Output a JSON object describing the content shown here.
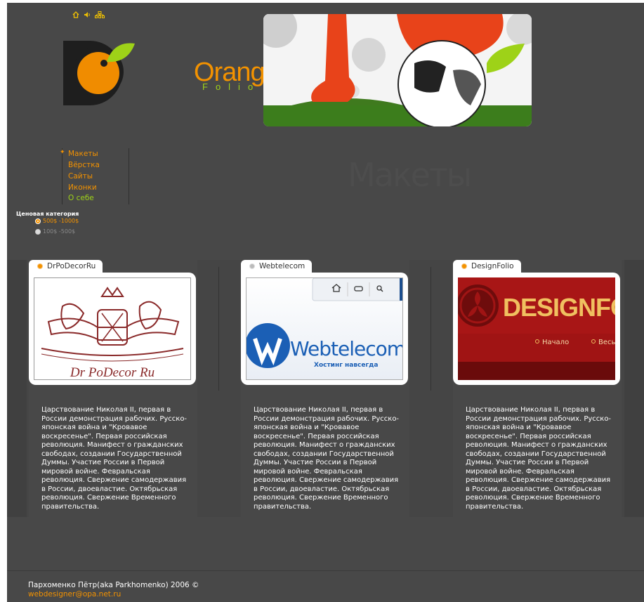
{
  "header": {
    "icons": [
      "home-icon",
      "speaker-icon",
      "sitemap-icon"
    ],
    "logo": {
      "word": "Orange",
      "sub": "Folio",
      "alt": "OrangeFolio"
    }
  },
  "colors": {
    "accent": "#f39200",
    "green": "#9ed218",
    "background": "#484848"
  },
  "nav": {
    "items": [
      {
        "label": "Макеты"
      },
      {
        "label": "Вёрстка"
      },
      {
        "label": "Сайты"
      },
      {
        "label": "Иконки"
      },
      {
        "label": "О себе"
      }
    ]
  },
  "page_title": "Макеты",
  "price": {
    "title": "Ценовая категория",
    "options": [
      {
        "label": "500$ -1000$",
        "selected": true
      },
      {
        "label": "100$ -500$",
        "selected": false
      }
    ]
  },
  "portfolio": [
    {
      "tab": "DrPoDecorRu",
      "thumb_text": "Dr PoDecor Ru",
      "desc": "Царствование Николая II, первая в России демонстрация рабочих. Русско-японская война и \"Кровавое воскресенье\". Первая российская революция. Манифест о гражданских свободах, создании Государственной Думмы. Участие России в Первой мировой войне. Февральская революция. Свержение самодержавия в России, двоевластие. Октябрьская революция. Свержение Временного правительства."
    },
    {
      "tab": "Webtelecom",
      "thumb_text": "Webtelecom",
      "thumb_sub": "Хостинг навсегда",
      "desc": "Царствование Николая II, первая в России демонстрация рабочих. Русско-японская война и \"Кровавое воскресенье\". Первая российская революция. Манифест о гражданских свободах, создании Государственной Думмы. Участие России в Первой мировой войне. Февральская революция. Свержение самодержавия в России, двоевластие. Октябрьская революция. Свержение Временного правительства."
    },
    {
      "tab": "DesignFolio",
      "thumb_text": "DESIGNFO",
      "thumb_nav": [
        "Начало",
        "Весь"
      ],
      "desc": "Царствование Николая II, первая в России демонстрация рабочих. Русско-японская война и \"Кровавое воскресенье\". Первая российская революция. Манифест о гражданских свободах, создании Государственной Думмы. Участие России в Первой мировой войне. Февральская революция. Свержение самодержавия в России, двоевластие. Октябрьская революция. Свержение Временного правительства."
    }
  ],
  "footer": {
    "copyright": "Пархоменко Пётр(aka Parkhomenko) 2006 ©",
    "email": "webdesigner@opa.net.ru"
  }
}
